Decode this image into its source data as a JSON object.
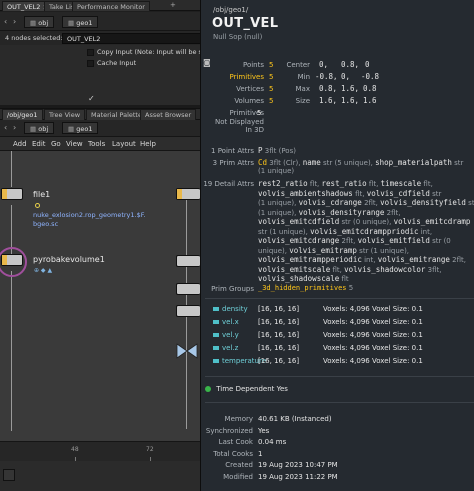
{
  "top_pane": {
    "tabs": [
      "OUT_VEL2",
      "Take List",
      "Performance Monitor"
    ],
    "path": [
      "obj",
      "geo1"
    ],
    "nodes_selected_label": "4 nodes selected:",
    "nodes_selected_value": "OUT_VEL2",
    "copy_input_label": "Copy Input (Note: Input will be still co",
    "cache_input_label": "Cache Input",
    "copy_input_checked": true,
    "cache_input_checked": false
  },
  "network_pane": {
    "tabs": [
      "/obj/geo1",
      "Tree View",
      "Material Palette",
      "Asset Browser"
    ],
    "path": [
      "obj",
      "geo1"
    ],
    "menu": [
      "Add",
      "Edit",
      "Go",
      "View",
      "Tools",
      "Layout",
      "Help"
    ],
    "nodes": {
      "file1": {
        "name": "file1",
        "file": "nuke_exlosion2.rop_geometry1.$F.",
        "file2": "bgeo.sc"
      },
      "pyro": {
        "name": "pyrobakevolume1"
      }
    },
    "timeline_ticks": [
      "48",
      "72"
    ]
  },
  "info": {
    "path": "/obj/geo1/",
    "title": "OUT_VEL",
    "type": "Null Sop (null)",
    "counts": [
      {
        "label": "Points",
        "value": "5"
      },
      {
        "label": "Primitives",
        "value": "5"
      },
      {
        "label": "Vertices",
        "value": "5"
      },
      {
        "label": "Volumes",
        "value": "5"
      }
    ],
    "bounds": [
      {
        "label": "Center",
        "values": [
          "0,",
          "0.8,",
          "0"
        ]
      },
      {
        "label": "Min",
        "values": [
          "-0.8,",
          "0,",
          "-0.8"
        ]
      },
      {
        "label": "Max",
        "values": [
          "0.8,",
          "1.6,",
          "0.8"
        ]
      },
      {
        "label": "Size",
        "values": [
          "1.6,",
          "1.6,",
          "1.6"
        ]
      }
    ],
    "primitives_row": {
      "label": "Primitives",
      "value": "5"
    },
    "not_displayed": "Not Displayed",
    "in_3d": "In 3D",
    "point_attrs_label": "1 Point Attrs",
    "point_attrs": [
      {
        "name": "P",
        "type": "3flt (Pos)"
      }
    ],
    "prim_attrs_label": "3 Prim Attrs",
    "prim_attrs_line1": [
      {
        "name": "Cd",
        "type": "3flt (Clr),"
      },
      {
        "name": "name",
        "type": "str (5 unique),"
      },
      {
        "name": "shop_materialpath",
        "type": "str"
      }
    ],
    "prim_attrs_line2": "(1 unique)",
    "detail_attrs_label": "19 Detail Attrs",
    "detail_lines": [
      [
        [
          "rest2_ratio",
          "flt,"
        ],
        [
          "rest_ratio",
          "flt,"
        ],
        [
          "timescale",
          "flt,"
        ]
      ],
      [
        [
          "volvis_ambientshadows",
          "flt,"
        ],
        [
          "volvis_cdfield",
          "str"
        ]
      ],
      [
        [
          "",
          "(1 unique),"
        ],
        [
          "volvis_cdrange",
          "2flt,"
        ],
        [
          "volvis_densityfield",
          "str"
        ]
      ],
      [
        [
          "",
          "(1 unique),"
        ],
        [
          "volvis_densityrange",
          "2flt,"
        ]
      ],
      [
        [
          "volvis_emitcdfield",
          "str (0 unique),"
        ],
        [
          "volvis_emitcdramp",
          ""
        ]
      ],
      [
        [
          "",
          "str (1 unique),"
        ],
        [
          "volvis_emitcdramppriodic",
          "int,"
        ]
      ],
      [
        [
          "volvis_emitcdrange",
          "2flt,"
        ],
        [
          "volvis_emitfield",
          "str (0"
        ]
      ],
      [
        [
          "",
          "unique),"
        ],
        [
          "volvis_emitramp",
          "str (1 unique),"
        ]
      ],
      [
        [
          "volvis_emitrampperiodic",
          "int,"
        ],
        [
          "volvis_emitrange",
          "2flt,"
        ]
      ],
      [
        [
          "volvis_emitscale",
          "flt,"
        ],
        [
          "volvis_shadowcolor",
          "3flt,"
        ]
      ],
      [
        [
          "volvis_shadowscale",
          "flt"
        ]
      ]
    ],
    "prim_groups_label": "Prim Groups",
    "prim_groups_value": "_3d_hidden_primitives",
    "prim_groups_count": "5",
    "volumes": [
      {
        "name": "density",
        "res": "[16, 16, 16]",
        "voxels": "Voxels: 4,096 Voxel Size: 0.1"
      },
      {
        "name": "vel.x",
        "res": "[16, 16, 16]",
        "voxels": "Voxels: 4,096 Voxel Size: 0.1"
      },
      {
        "name": "vel.y",
        "res": "[16, 16, 16]",
        "voxels": "Voxels: 4,096 Voxel Size: 0.1"
      },
      {
        "name": "vel.z",
        "res": "[16, 16, 16]",
        "voxels": "Voxels: 4,096 Voxel Size: 0.1"
      },
      {
        "name": "temperature",
        "res": "[16, 16, 16]",
        "voxels": "Voxels: 4,096 Voxel Size: 0.1"
      }
    ],
    "time_dependent_label": "Time Dependent",
    "time_dependent_value": "Yes",
    "stats": [
      {
        "label": "Memory",
        "value": "40.61 KB (Instanced)"
      },
      {
        "label": "Synchronized",
        "value": "Yes"
      },
      {
        "label": "Last Cook",
        "value": "0.04 ms"
      },
      {
        "label": "Total Cooks",
        "value": "1"
      },
      {
        "label": "Created",
        "value": "19 Aug 2023 10:47 PM"
      },
      {
        "label": "Modified",
        "value": "19 Aug 2023 11:22 PM"
      }
    ]
  },
  "colors": {
    "accent": "#ffc61a",
    "volume": "#6fd0d8",
    "time_dependent": "#39b54a",
    "info_bg": "#252a30"
  }
}
